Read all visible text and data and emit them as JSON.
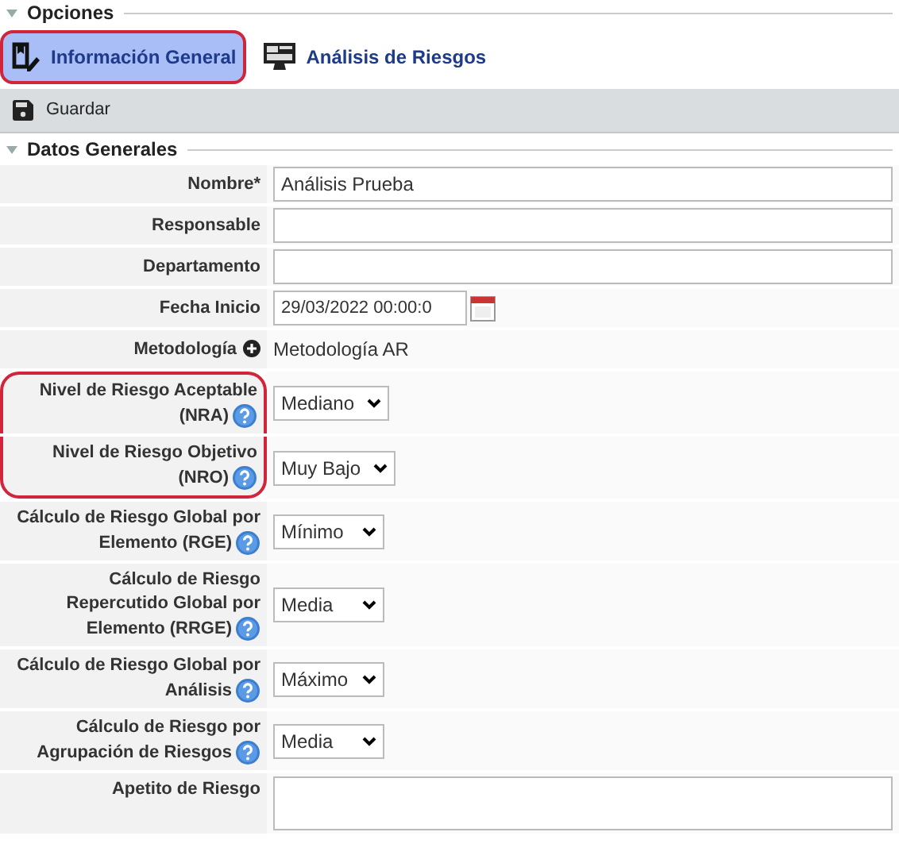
{
  "options_legend": "Opciones",
  "tabs": [
    {
      "label": "Información General",
      "selected": true,
      "highlighted": true
    },
    {
      "label": "Análisis de Riesgos",
      "selected": false,
      "highlighted": false
    }
  ],
  "toolbar": {
    "save_label": "Guardar"
  },
  "section_legend": "Datos Generales",
  "fields": [
    {
      "kind": "text",
      "label": "Nombre*",
      "value": "Análisis Prueba",
      "help": false,
      "highlighted": false
    },
    {
      "kind": "text",
      "label": "Responsable",
      "help": false,
      "highlighted": false
    },
    {
      "kind": "text",
      "label": "Departamento",
      "help": false,
      "highlighted": false
    },
    {
      "kind": "date",
      "label": "Fecha Inicio",
      "value": "29/03/2022 00:00:0",
      "help": false,
      "highlighted": false
    },
    {
      "kind": "static",
      "label": "Metodología",
      "value": "Metodología AR",
      "help": false,
      "highlighted": false
    },
    {
      "kind": "select",
      "label": "Nivel de Riesgo Aceptable (NRA)",
      "value": "Mediano",
      "help": true,
      "highlighted": true
    },
    {
      "kind": "select",
      "label": "Nivel de Riesgo Objetivo (NRO)",
      "value": "Muy Bajo",
      "help": true,
      "highlighted": true
    },
    {
      "kind": "select",
      "label": "Cálculo de Riesgo Global por Elemento (RGE)",
      "value": "Mínimo",
      "help": true,
      "highlighted": false
    },
    {
      "kind": "select",
      "label": "Cálculo de Riesgo Repercutido Global por Elemento (RRGE)",
      "value": "Media",
      "help": true,
      "highlighted": false
    },
    {
      "kind": "select",
      "label": "Cálculo de Riesgo Global por Análisis",
      "value": "Máximo",
      "help": true,
      "highlighted": false
    },
    {
      "kind": "select",
      "label": "Cálculo de Riesgo por Agrupación de Riesgos",
      "value": "Media",
      "help": true,
      "highlighted": false
    },
    {
      "kind": "textarea",
      "label": "Apetito de Riesgo",
      "help": false,
      "highlighted": false
    }
  ]
}
